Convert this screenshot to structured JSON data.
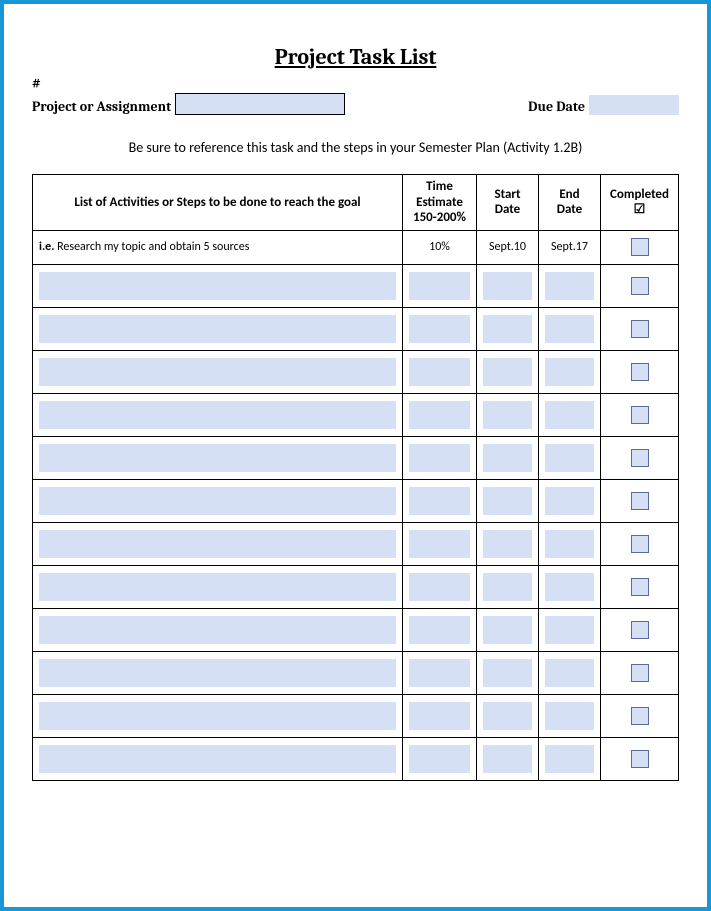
{
  "title": "Project Task List",
  "header": {
    "hash": "#",
    "project_label": "Project or Assignment",
    "due_label": "Due Date"
  },
  "instruction": "Be sure to reference this task and the steps in your Semester Plan (Activity 1.2B)",
  "columns": {
    "activity": "List of Activities or Steps to be done to reach the goal",
    "time_line1": "Time",
    "time_line2": "Estimate",
    "time_line3": "150-200%",
    "start_line1": "Start",
    "start_line2": "Date",
    "end_line1": "End",
    "end_line2": "Date",
    "completed": "Completed",
    "check": "☑"
  },
  "example": {
    "ie": "i.e.",
    "activity": " Research my topic and obtain 5 sources",
    "time": "10%",
    "start": "Sept.10",
    "end": "Sept.17"
  },
  "blank_rows": 12
}
